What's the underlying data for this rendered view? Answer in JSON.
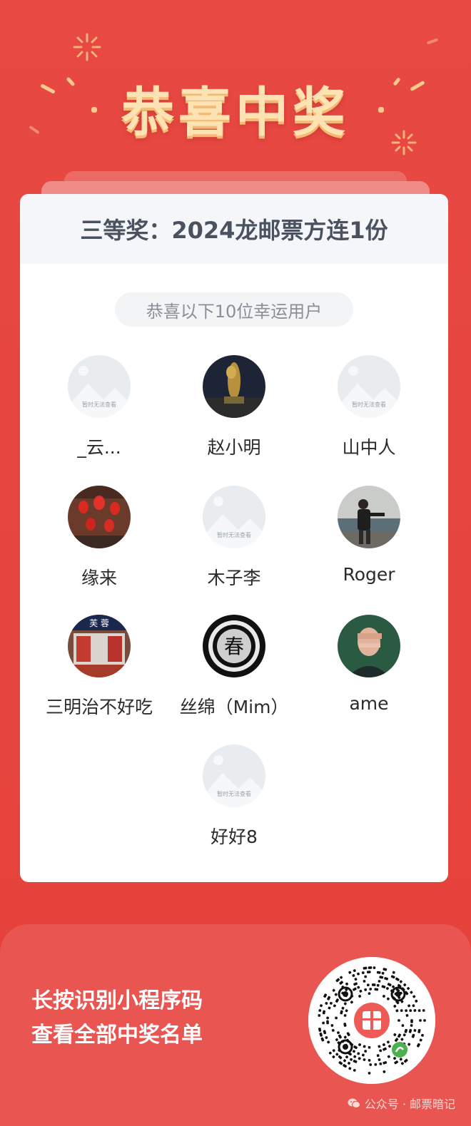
{
  "banner": {
    "title": "恭喜中奖"
  },
  "card": {
    "prize_title": "三等奖：2024龙邮票方连1份",
    "subtitle_pill": "恭喜以下10位幸运用户"
  },
  "placeholder_avatar_text": "暂时无法查看",
  "winners": [
    {
      "name": "_云...",
      "avatar": "placeholder-avatar"
    },
    {
      "name": "赵小明",
      "avatar": "statue-photo-avatar"
    },
    {
      "name": "山中人",
      "avatar": "placeholder-avatar"
    },
    {
      "name": "缘来",
      "avatar": "lanterns-photo-avatar"
    },
    {
      "name": "木子李",
      "avatar": "placeholder-avatar"
    },
    {
      "name": "Roger",
      "avatar": "person-beach-photo-avatar"
    },
    {
      "name": "三明治不好吃",
      "avatar": "storefront-photo-avatar"
    },
    {
      "name": "丝绵（Mim）",
      "avatar": "spring-symbol-avatar"
    },
    {
      "name": "ame",
      "avatar": "blurred-portrait-avatar"
    },
    {
      "name": "好好8",
      "avatar": "placeholder-avatar"
    }
  ],
  "cta": {
    "line1": "长按识别小程序码",
    "line2": "查看全部中奖名单"
  },
  "footer": {
    "label": "公众号 · 邮票暗记"
  },
  "colors": {
    "background": "#e8453f",
    "title": "#fde3b4",
    "card": "#ffffff",
    "head_bg": "#f4f6f9"
  }
}
